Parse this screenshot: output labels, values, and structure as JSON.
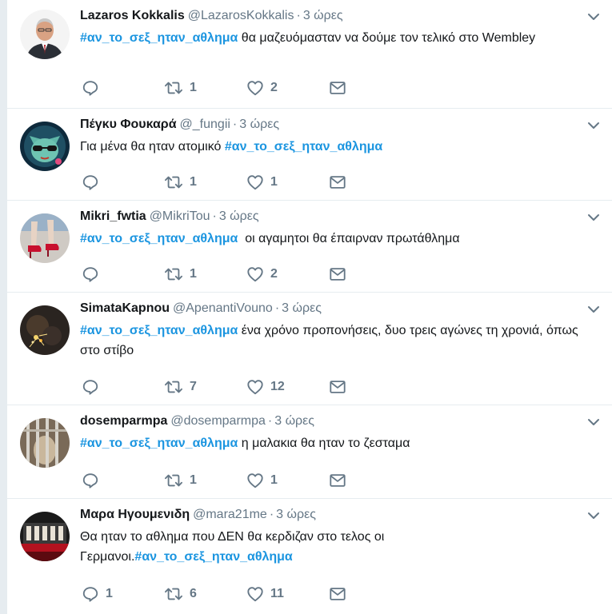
{
  "tweets": [
    {
      "fullname": "Lazaros Kokkalis",
      "username": "@LazarosKokkalis",
      "time": "3 ώρες",
      "text_before": "",
      "hashtag": "#αν_το_σεξ_ηταν_αθλημα",
      "text_after": " θα μαζευόμασταν να δούμε τον τελικό στο Wembley",
      "replies": "",
      "retweets": "1",
      "likes": "2",
      "avatar_icon": "man-portrait-avatar"
    },
    {
      "fullname": "Πέγκυ Φουκαρά",
      "username": "@_fungii",
      "time": "3 ώρες",
      "text_before": "Για μένα θα ηταν ατομικό ",
      "hashtag": "#αν_το_σεξ_ηταν_αθλημα",
      "text_after": "",
      "replies": "",
      "retweets": "1",
      "likes": "1",
      "avatar_icon": "cat-sunglasses-avatar"
    },
    {
      "fullname": "Mikri_fwtia",
      "username": "@MikriTou",
      "time": "3 ώρες",
      "text_before": "",
      "hashtag": "#αν_το_σεξ_ηταν_αθλημα",
      "text_after": "  οι αγαμητοι θα έπαιρναν πρωτάθλημα",
      "replies": "",
      "retweets": "1",
      "likes": "2",
      "avatar_icon": "red-shoes-avatar"
    },
    {
      "fullname": "SimataKapnou",
      "username": "@ApenantiVouno",
      "time": "3 ώρες",
      "text_before": "",
      "hashtag": "#αν_το_σεξ_ηταν_αθλημα",
      "text_after": " ένα χρόνο προπονήσεις, δυο τρεις αγώνες τη χρονιά, όπως στο στίβο",
      "replies": "",
      "retweets": "7",
      "likes": "12",
      "avatar_icon": "dark-sparkle-avatar"
    },
    {
      "fullname": "dosemparmpa",
      "username": "@dosemparmpa",
      "time": "3 ώρες",
      "text_before": "",
      "hashtag": "#αν_το_σεξ_ηταν_αθλημα",
      "text_after": " η μαλακια θα ηταν το ζεσταμα",
      "replies": "",
      "retweets": "1",
      "likes": "1",
      "avatar_icon": "prison-bars-avatar"
    },
    {
      "fullname": "Μαρα Ηγουμενιδη",
      "username": "@mara21me",
      "time": "3 ώρες",
      "text_before": "Θα ηταν το αθλημα που ΔΕΝ θα κερδιζαν στο τελος οι Γερμανοι.",
      "hashtag": "#αν_το_σεξ_ηταν_αθλημα",
      "text_after": "",
      "replies": "1",
      "retweets": "6",
      "likes": "11",
      "avatar_icon": "theater-stage-avatar"
    }
  ],
  "colors": {
    "hashtag": "#1b95e0",
    "secondary": "#657786",
    "divider": "#e6ecf0",
    "background": "#e6ecf0"
  },
  "icons": {
    "caret": "chevron-down-icon",
    "reply": "reply-icon",
    "retweet": "retweet-icon",
    "like": "heart-icon",
    "dm": "envelope-icon"
  }
}
